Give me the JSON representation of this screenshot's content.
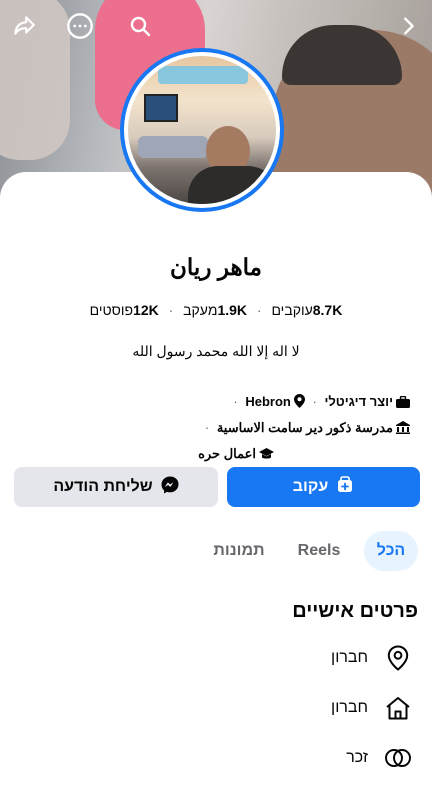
{
  "profile": {
    "name": "ماهر ريان",
    "stats": {
      "followers_value": "8.7K",
      "followers_label": "עוקבים",
      "following_value": "1.9K",
      "following_label": "מעקב",
      "posts_value": "12K",
      "posts_label": "פוסטים"
    },
    "bio": "لا اله إلا الله محمد رسول الله",
    "meta": {
      "creator": "יוצר דיגיטלי",
      "location": "Hebron",
      "school": "مدرسة ذكور دير سامت الاساسية",
      "work": "اعمال حره"
    }
  },
  "buttons": {
    "follow_label": "עקוב",
    "message_label": "שליחת הודעה"
  },
  "tabs": [
    {
      "label": "הכל"
    },
    {
      "label": "Reels"
    },
    {
      "label": "תמונות"
    }
  ],
  "details": {
    "title": "פרטים אישיים",
    "items": [
      {
        "icon": "location-pin-icon",
        "text": "חברון"
      },
      {
        "icon": "home-icon",
        "text": "חברון"
      },
      {
        "icon": "gender-icon",
        "text": "זכר"
      }
    ]
  },
  "colors": {
    "accent": "#1877f2",
    "tab_active_bg": "#e7f3ff",
    "secondary_button": "#e4e6eb"
  }
}
